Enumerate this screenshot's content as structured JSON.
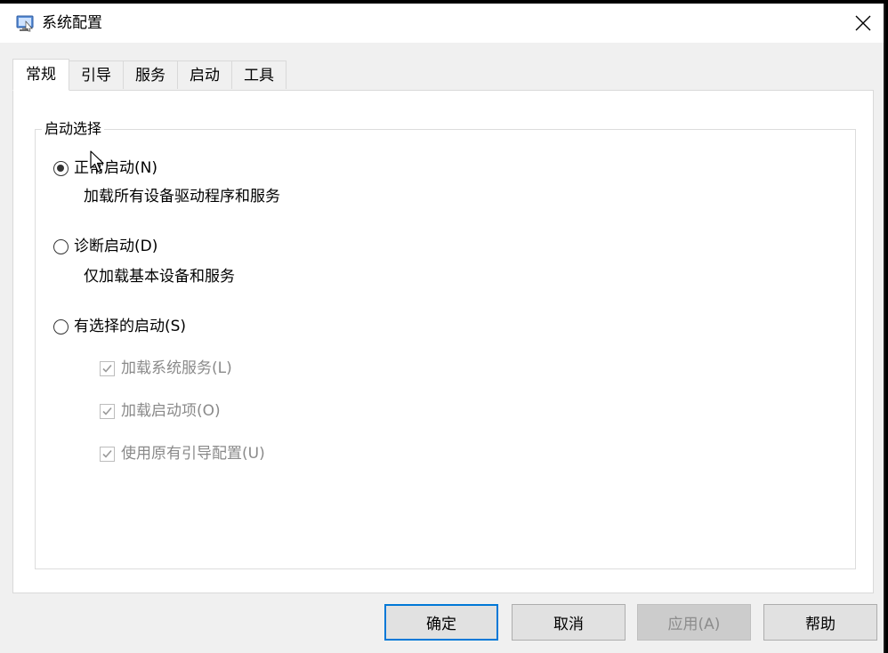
{
  "window": {
    "title": "系统配置",
    "icon": "msconfig-app-icon",
    "close_icon": "close-icon"
  },
  "tabs": [
    {
      "label": "常规",
      "active": true
    },
    {
      "label": "引导",
      "active": false
    },
    {
      "label": "服务",
      "active": false
    },
    {
      "label": "启动",
      "active": false
    },
    {
      "label": "工具",
      "active": false
    }
  ],
  "general": {
    "group_title": "启动选择",
    "normal": {
      "label": "正常启动(N)",
      "description": "加载所有设备驱动程序和服务",
      "checked": true
    },
    "diagnostic": {
      "label": "诊断启动(D)",
      "description": "仅加载基本设备和服务",
      "checked": false
    },
    "selective": {
      "label": "有选择的启动(S)",
      "checked": false,
      "options": [
        {
          "label": "加载系统服务(L)",
          "checked": true,
          "enabled": false
        },
        {
          "label": "加载启动项(O)",
          "checked": true,
          "enabled": false
        },
        {
          "label": "使用原有引导配置(U)",
          "checked": true,
          "enabled": false
        }
      ]
    }
  },
  "buttons": {
    "ok": "确定",
    "cancel": "取消",
    "apply": "应用(A)",
    "help": "帮助"
  },
  "colors": {
    "window_bg": "#f0f0f0",
    "panel_bg": "#ffffff",
    "accent": "#0078d7",
    "disabled_text": "#8a8a8a"
  }
}
